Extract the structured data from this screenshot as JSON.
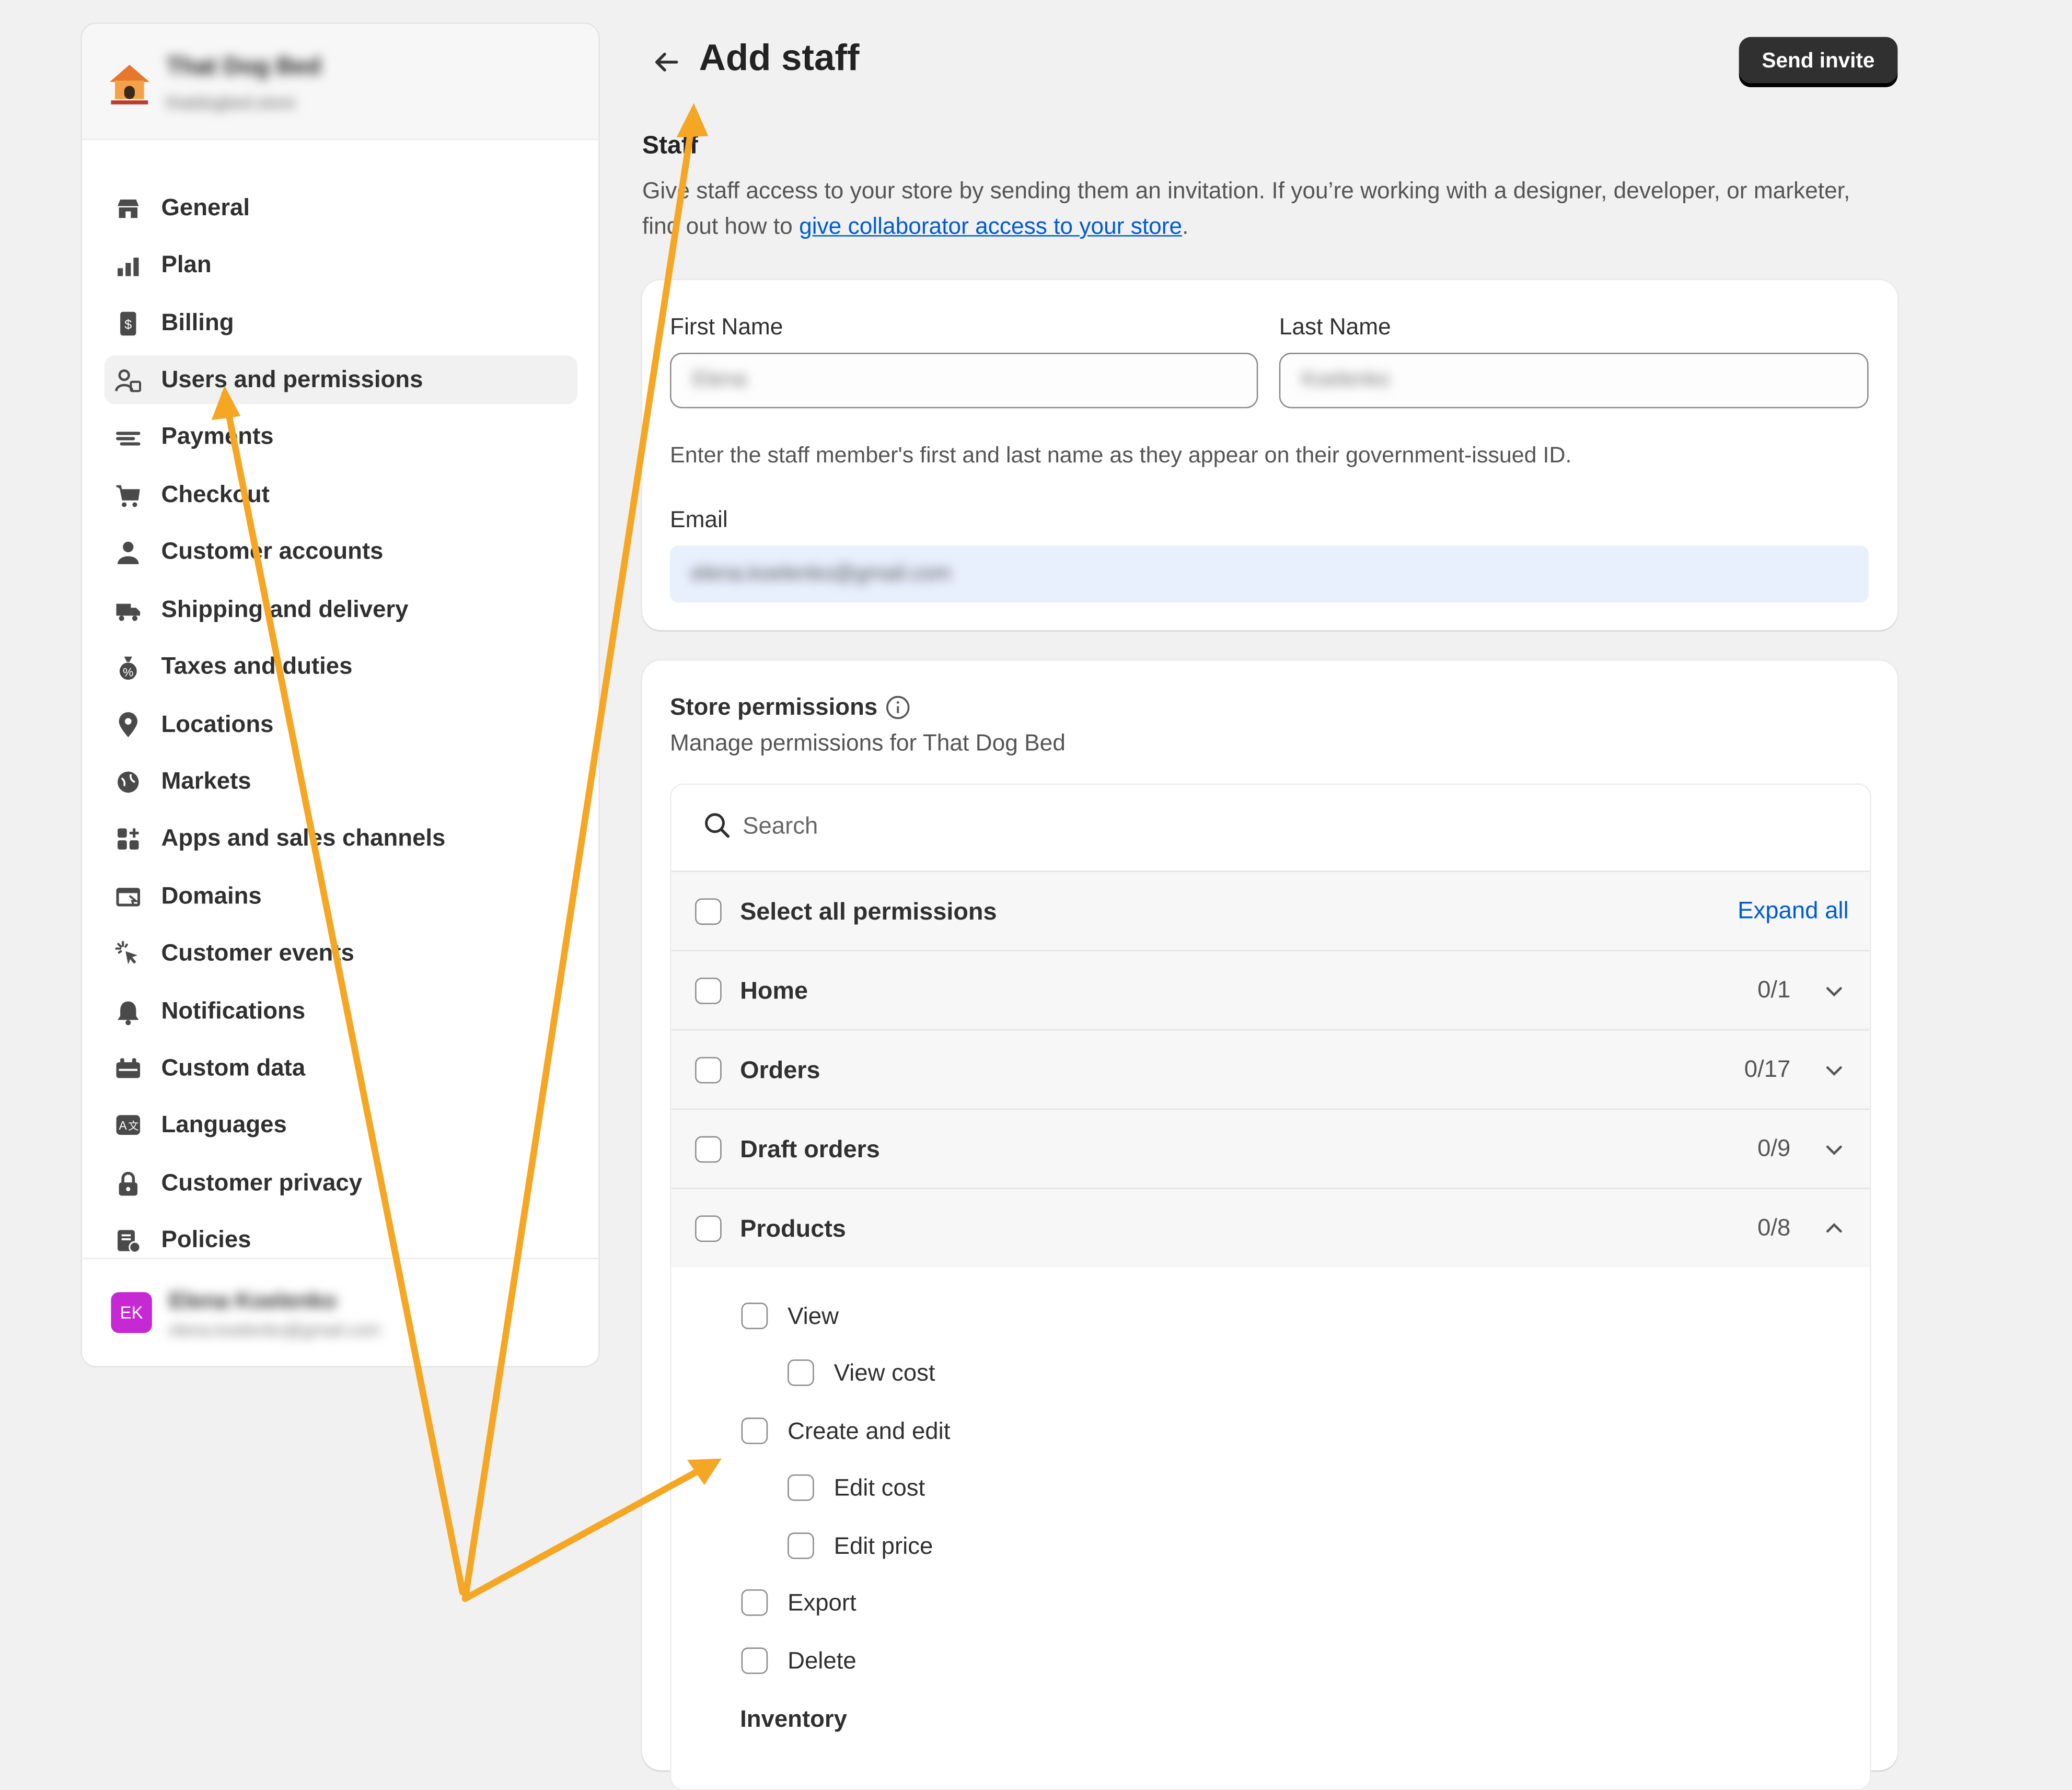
{
  "colors": {
    "accent_link": "#005bd3",
    "primary_button": "#303030",
    "avatar": "#c629d3",
    "annotation_arrow": "#f5a623"
  },
  "sidebar": {
    "store_name": "That Dog Bed",
    "store_domain": "thatdogbed.store",
    "items": [
      {
        "label": "General",
        "icon": "store-icon"
      },
      {
        "label": "Plan",
        "icon": "plan-icon"
      },
      {
        "label": "Billing",
        "icon": "billing-icon"
      },
      {
        "label": "Users and permissions",
        "icon": "users-icon",
        "active": true
      },
      {
        "label": "Payments",
        "icon": "payments-icon"
      },
      {
        "label": "Checkout",
        "icon": "cart-icon"
      },
      {
        "label": "Customer accounts",
        "icon": "person-icon"
      },
      {
        "label": "Shipping and delivery",
        "icon": "truck-icon"
      },
      {
        "label": "Taxes and duties",
        "icon": "taxes-icon"
      },
      {
        "label": "Locations",
        "icon": "location-pin-icon"
      },
      {
        "label": "Markets",
        "icon": "globe-icon"
      },
      {
        "label": "Apps and sales channels",
        "icon": "apps-icon"
      },
      {
        "label": "Domains",
        "icon": "domains-icon"
      },
      {
        "label": "Customer events",
        "icon": "cursor-click-icon"
      },
      {
        "label": "Notifications",
        "icon": "bell-icon"
      },
      {
        "label": "Custom data",
        "icon": "custom-data-icon"
      },
      {
        "label": "Languages",
        "icon": "translate-icon"
      },
      {
        "label": "Customer privacy",
        "icon": "lock-icon"
      },
      {
        "label": "Policies",
        "icon": "policies-icon"
      }
    ],
    "user": {
      "initials": "EK",
      "name": "Elena Koelenko",
      "email": "elena.koelenko@gmail.com"
    }
  },
  "header": {
    "title": "Add staff",
    "send_invite_label": "Send invite"
  },
  "staff_section": {
    "heading": "Staff",
    "description_before": "Give staff access to your store by sending them an invitation. If you’re working with a designer, developer, or marketer, find out how to ",
    "link_text": "give collaborator access to your store",
    "description_after": "."
  },
  "name_form": {
    "first_name_label": "First Name",
    "first_name_value": "Elena",
    "last_name_label": "Last Name",
    "last_name_value": "Koelenko",
    "help_text": "Enter the staff member's first and last name as they appear on their government-issued ID.",
    "email_label": "Email",
    "email_value": "elena.koelenko@gmail.com"
  },
  "permissions": {
    "title": "Store permissions",
    "subtitle": "Manage permissions for That Dog Bed",
    "search_placeholder": "Search",
    "select_all_label": "Select all permissions",
    "expand_all_label": "Expand all",
    "groups": [
      {
        "label": "Home",
        "count": "0/1",
        "expanded": false
      },
      {
        "label": "Orders",
        "count": "0/17",
        "expanded": false
      },
      {
        "label": "Draft orders",
        "count": "0/9",
        "expanded": false
      },
      {
        "label": "Products",
        "count": "0/8",
        "expanded": true
      }
    ],
    "product_items": [
      {
        "label": "View",
        "level": 1
      },
      {
        "label": "View cost",
        "level": 2
      },
      {
        "label": "Create and edit",
        "level": 1
      },
      {
        "label": "Edit cost",
        "level": 2
      },
      {
        "label": "Edit price",
        "level": 2
      },
      {
        "label": "Export",
        "level": 1
      },
      {
        "label": "Delete",
        "level": 1
      }
    ],
    "inventory_label": "Inventory"
  }
}
